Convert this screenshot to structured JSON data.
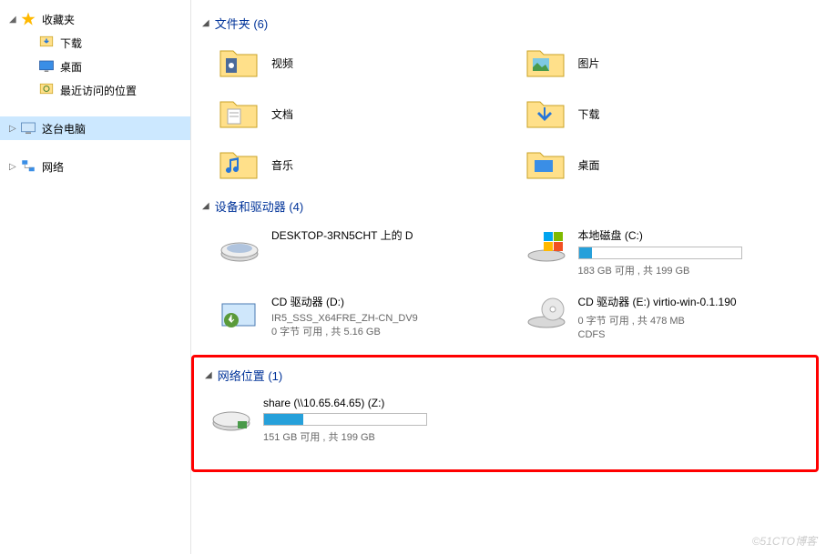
{
  "sidebar": {
    "favorites": {
      "label": "收藏夹"
    },
    "downloads": {
      "label": "下载"
    },
    "desktop": {
      "label": "桌面"
    },
    "recent": {
      "label": "最近访问的位置"
    },
    "thispc": {
      "label": "这台电脑"
    },
    "network": {
      "label": "网络"
    }
  },
  "sections": {
    "folders": {
      "title": "文件夹 (6)"
    },
    "devices": {
      "title": "设备和驱动器 (4)"
    },
    "netloc": {
      "title": "网络位置 (1)"
    }
  },
  "folders": [
    {
      "label": "视频"
    },
    {
      "label": "图片"
    },
    {
      "label": "文档"
    },
    {
      "label": "下载"
    },
    {
      "label": "音乐"
    },
    {
      "label": "桌面"
    }
  ],
  "drives": [
    {
      "name": "DESKTOP-3RN5CHT 上的 D",
      "bar": null,
      "status": ""
    },
    {
      "name": "本地磁盘 (C:)",
      "bar": 8,
      "status": "183 GB 可用 , 共 199 GB"
    },
    {
      "name": "CD 驱动器 (D:)",
      "sub": "IR5_SSS_X64FRE_ZH-CN_DV9",
      "status": "0 字节 可用 , 共 5.16 GB"
    },
    {
      "name": "CD 驱动器 (E:) virtio-win-0.1.190",
      "status": "0 字节 可用 , 共 478 MB",
      "extra": "CDFS"
    }
  ],
  "netdrives": [
    {
      "name": "share (\\\\10.65.64.65) (Z:)",
      "bar": 24,
      "status": "151 GB 可用 , 共 199 GB"
    }
  ],
  "watermark": "©51CTO博客"
}
